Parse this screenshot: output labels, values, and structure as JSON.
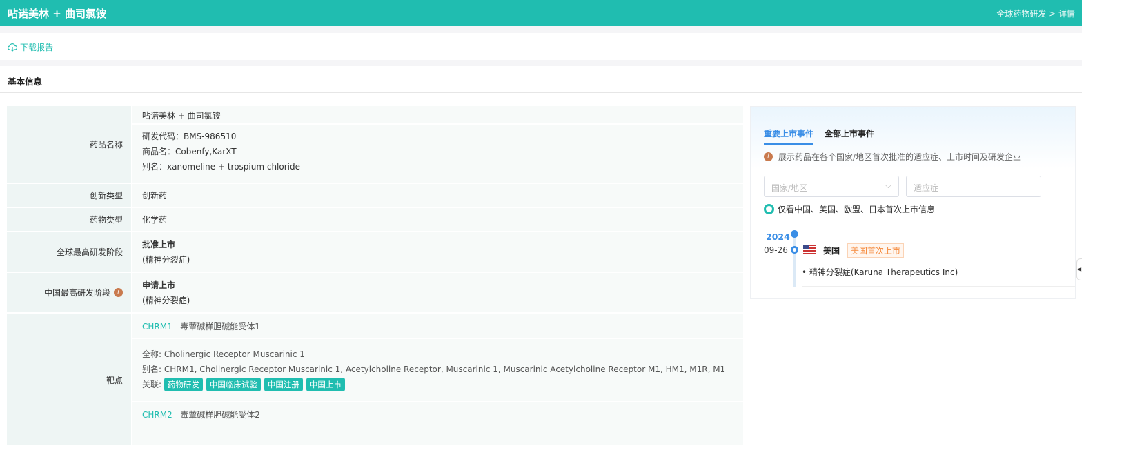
{
  "header": {
    "title": "呫诺美林 + 曲司氯铵",
    "breadcrumb": "全球药物研发 > 详情"
  },
  "toolbar": {
    "download_label": "下载报告"
  },
  "section": {
    "title": "基本信息"
  },
  "basic": {
    "name_label": "药品名称",
    "name_value": "呫诺美林 + 曲司氯铵",
    "code": "研发代码：BMS-986510",
    "trade": "商品名：Cobenfy,KarXT",
    "alias": "别名：xanomeline + trospium chloride",
    "innov_label": "创新类型",
    "innov_value": "创新药",
    "type_label": "药物类型",
    "type_value": "化学药",
    "global_label": "全球最高研发阶段",
    "global_stage": "批准上市",
    "global_ind": "(精神分裂症)",
    "china_label": "中国最高研发阶段",
    "china_stage": "申请上市",
    "china_ind": "(精神分裂症)",
    "target_label": "靶点"
  },
  "targets": [
    {
      "code": "CHRM1",
      "name": "毒蕈碱样胆碱能受体1",
      "full_label": "全称:",
      "full": "Cholinergic Receptor Muscarinic 1",
      "alias_label": "别名:",
      "alias": "CHRM1, Cholinergic Receptor Muscarinic 1, Acetylcholine Receptor, Muscarinic 1, Muscarinic Acetylcholine Receptor M1, HM1, M1R, M1",
      "rel_label": "关联:",
      "tags": [
        "药物研发",
        "中国临床试验",
        "中国注册",
        "中国上市"
      ]
    },
    {
      "code": "CHRM2",
      "name": "毒蕈碱样胆碱能受体2"
    }
  ],
  "events": {
    "tabs": [
      "重要上市事件",
      "全部上市事件"
    ],
    "note": "展示药品在各个国家/地区首次批准的适应症、上市时间及研发企业",
    "country_placeholder": "国家/地区",
    "indication_placeholder": "适应症",
    "toggle_label": "仅看中国、美国、欧盟、日本首次上市信息",
    "year": "2024",
    "date": "09-26",
    "country": "美国",
    "badge": "美国首次上市",
    "item": "精神分裂症(Karuna Therapeutics Inc)"
  },
  "colors": {
    "primary": "#20bdb0",
    "accent": "#3a8ee6",
    "badge": "#f58a3c"
  }
}
